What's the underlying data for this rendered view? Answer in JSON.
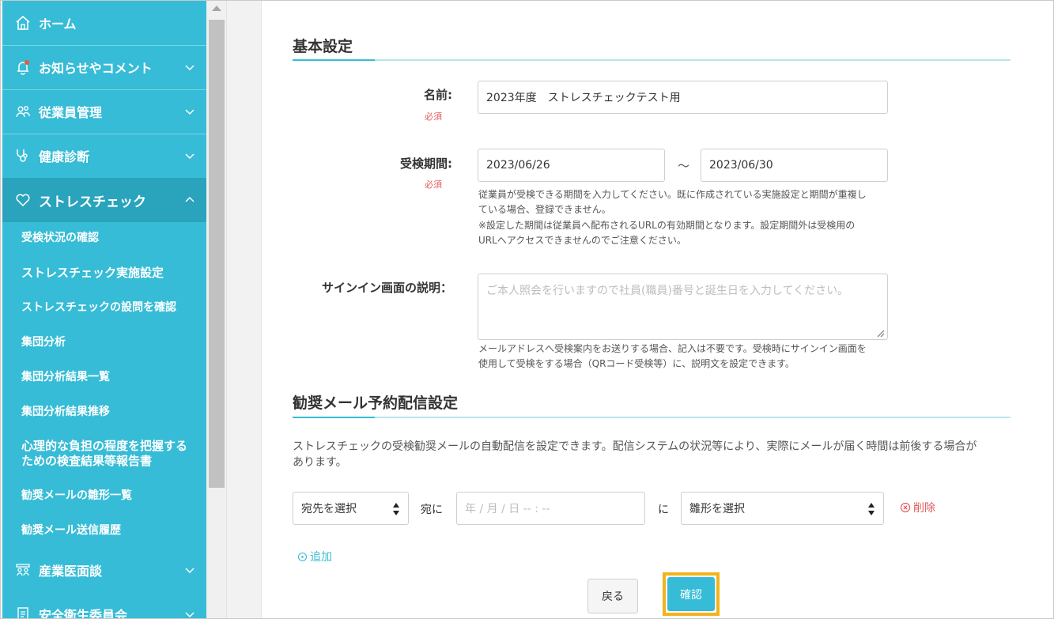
{
  "sidebar": {
    "home": "ホーム",
    "notices": "お知らせやコメント",
    "employees": "従業員管理",
    "health_checkup": "健康診断",
    "stress_check": "ストレスチェック",
    "sub_items": [
      "受検状況の確認",
      "ストレスチェック実施設定",
      "ストレスチェックの設問を確認",
      "集団分析",
      "集団分析結果一覧",
      "集団分析結果推移",
      "心理的な負担の程度を把握するための検査結果等報告書",
      "勧奨メールの雛形一覧",
      "勧奨メール送信履歴"
    ],
    "sub_item_7_line1": "心理的な負担の程度を把握する",
    "sub_item_7_line2": "ための検査結果等報告書",
    "industrial_physician": "産業医面談",
    "safety_committee": "安全衛生委員会",
    "colors": {
      "background": "#36bcd6",
      "active": "#2aa3bc"
    }
  },
  "basic": {
    "title": "基本設定",
    "name_label": "名前:",
    "required": "必須",
    "name_value": "2023年度　ストレスチェックテスト用",
    "period_label": "受検期間:",
    "period_start": "2023/06/26",
    "period_separator": "～",
    "period_end": "2023/06/30",
    "period_help_1a": "従業員が受検できる期間を入力してください。既に作成されている実施設定と期間が重複し",
    "period_help_1b": "ている場合、登録できません。",
    "period_help_2a": "※設定した期間は従業員へ配布されるURLの有効期間となります。設定期間外は受検用の",
    "period_help_2b": "URLへアクセスできませんのでご注意ください。",
    "signin_label": "サインイン画面の説明：",
    "signin_placeholder": "ご本人照会を行いますので社員(職員)番号と誕生日を入力してください。",
    "signin_help_a": "メールアドレスへ受検案内をお送りする場合、記入は不要です。受検時にサインイン画面を",
    "signin_help_b": "使用して受検をする場合（QRコード受検等）に、説明文を設定できます。"
  },
  "mail": {
    "title": "勧奨メール予約配信設定",
    "desc_a": "ストレスチェックの受検勧奨メールの自動配信を設定できます。配信システムの状況等により、実際にメールが届く時間は前後する場合が",
    "desc_b": "あります。",
    "recipient_select": "宛先を選択",
    "to_text": "宛に",
    "datetime_placeholder": "年 / 月 / 日 -- : --",
    "ni_text": "に",
    "template_select": "雛形を選択",
    "delete": "削除",
    "add": "追加",
    "accent_color": "#36bcd6",
    "delete_color": "#e05b5b"
  },
  "footer": {
    "back": "戻る",
    "confirm": "確認",
    "highlight_color": "#f3b31a"
  }
}
